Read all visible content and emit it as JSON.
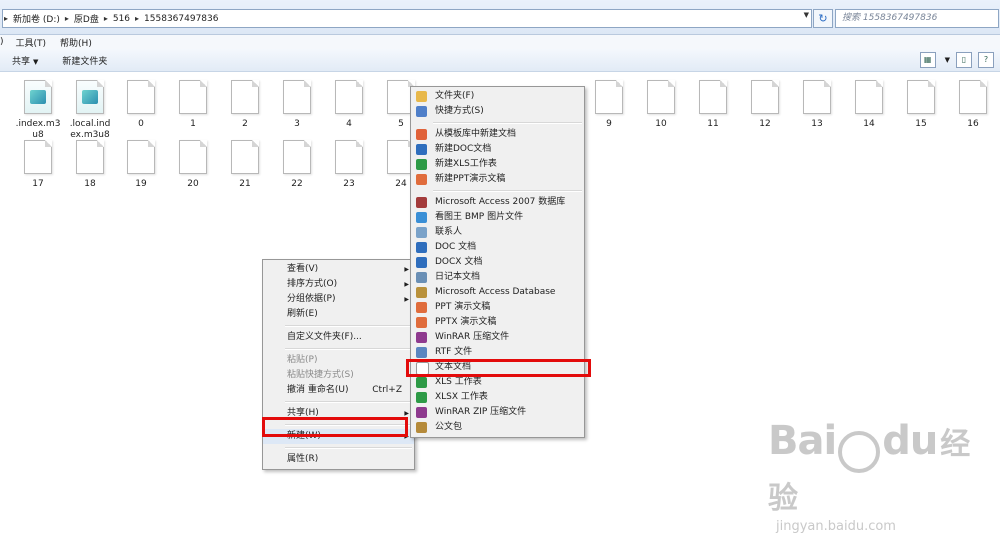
{
  "address": {
    "crumbs": [
      "新加卷 (D:)",
      "原D盘",
      "516",
      "1558367497836"
    ],
    "search_placeholder": "搜索 1558367497836"
  },
  "menubar": {
    "left_fragment": ")",
    "items": [
      "工具(T)",
      "帮助(H)"
    ]
  },
  "toolbar": {
    "share": "共享",
    "new_folder": "新建文件夹"
  },
  "files": [
    {
      "name": ".index.m3u8",
      "type": "media"
    },
    {
      "name": ".local.index.m3u8",
      "type": "media"
    },
    {
      "name": "0"
    },
    {
      "name": "1"
    },
    {
      "name": "2"
    },
    {
      "name": "3"
    },
    {
      "name": "4"
    },
    {
      "name": "5"
    },
    {
      "name": "9"
    },
    {
      "name": "10"
    },
    {
      "name": "11"
    },
    {
      "name": "12"
    },
    {
      "name": "13"
    },
    {
      "name": "14"
    },
    {
      "name": "15"
    },
    {
      "name": "16"
    },
    {
      "name": "17"
    },
    {
      "name": "18"
    },
    {
      "name": "19"
    },
    {
      "name": "20"
    },
    {
      "name": "21"
    },
    {
      "name": "22"
    },
    {
      "name": "23"
    },
    {
      "name": "24"
    }
  ],
  "context_menu": {
    "view": "查看(V)",
    "sort": "排序方式(O)",
    "group": "分组依据(P)",
    "refresh": "刷新(E)",
    "customize": "自定义文件夹(F)...",
    "paste": "粘贴(P)",
    "paste_shortcut": "粘贴快捷方式(S)",
    "undo": "撤消 重命名(U)",
    "undo_shortcut": "Ctrl+Z",
    "share": "共享(H)",
    "new": "新建(W)",
    "properties": "属性(R)"
  },
  "new_submenu": {
    "items": [
      {
        "label": "文件夹(F)",
        "icon": "folder-icon",
        "color": "#e8b84a"
      },
      {
        "label": "快捷方式(S)",
        "icon": "shortcut-icon",
        "color": "#4f7fc9"
      },
      {
        "sep": true
      },
      {
        "label": "从模板库中新建文档",
        "icon": "template-icon",
        "color": "#e0623a"
      },
      {
        "label": "新建DOC文档",
        "icon": "doc-icon",
        "color": "#2f6ebd"
      },
      {
        "label": "新建XLS工作表",
        "icon": "xls-icon",
        "color": "#2d9a46"
      },
      {
        "label": "新建PPT演示文稿",
        "icon": "ppt-icon",
        "color": "#e06c3c"
      },
      {
        "sep": true
      },
      {
        "label": "Microsoft Access 2007 数据库",
        "icon": "access-icon",
        "color": "#a33b3b"
      },
      {
        "label": "看图王 BMP 图片文件",
        "icon": "image-viewer-icon",
        "color": "#3a8fd6"
      },
      {
        "label": "联系人",
        "icon": "contact-icon",
        "color": "#7aa2c9"
      },
      {
        "label": "DOC 文档",
        "icon": "doc-icon",
        "color": "#2f6ebd"
      },
      {
        "label": "DOCX 文档",
        "icon": "docx-icon",
        "color": "#2f6ebd"
      },
      {
        "label": "日记本文档",
        "icon": "journal-icon",
        "color": "#6a8fb5"
      },
      {
        "label": "Microsoft Access Database",
        "icon": "access-icon",
        "color": "#b9913b"
      },
      {
        "label": "PPT 演示文稿",
        "icon": "ppt-icon",
        "color": "#e06c3c"
      },
      {
        "label": "PPTX 演示文稿",
        "icon": "pptx-icon",
        "color": "#e06c3c"
      },
      {
        "label": "WinRAR 压缩文件",
        "icon": "winrar-icon",
        "color": "#8e3a8e"
      },
      {
        "label": "RTF 文件",
        "icon": "rtf-icon",
        "color": "#5a86c0"
      },
      {
        "label": "文本文档",
        "icon": "text-file-icon",
        "color": "#ffffff"
      },
      {
        "label": "XLS 工作表",
        "icon": "xls-icon",
        "color": "#2d9a46"
      },
      {
        "label": "XLSX 工作表",
        "icon": "xlsx-icon",
        "color": "#2d9a46"
      },
      {
        "label": "WinRAR ZIP 压缩文件",
        "icon": "winrar-zip-icon",
        "color": "#8e3a8e"
      },
      {
        "label": "公文包",
        "icon": "briefcase-icon",
        "color": "#b58a3a"
      }
    ]
  },
  "watermark": {
    "brand": "Bai",
    "brand2": "du",
    "cn": "经验",
    "url": "jingyan.baidu.com"
  },
  "colors": {
    "highlight": "#e30b0b"
  }
}
